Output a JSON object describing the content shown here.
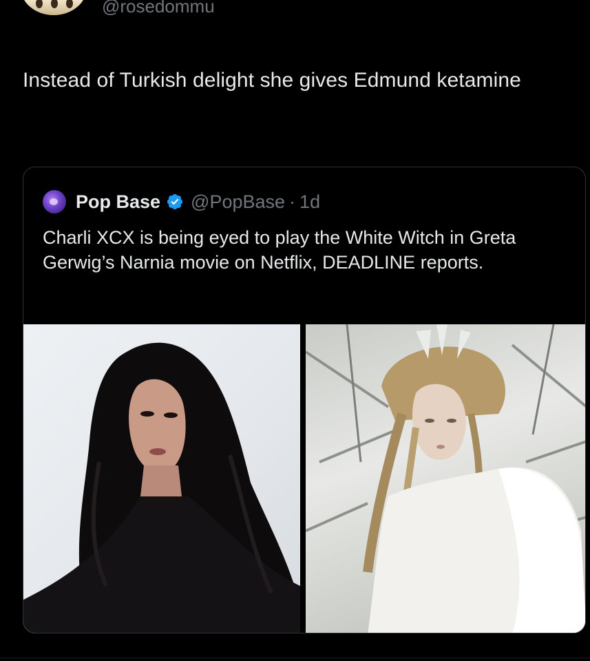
{
  "header": {
    "handle": "@rosedommu"
  },
  "tweet": {
    "text": "Instead of Turkish delight she gives Edmund ketamine"
  },
  "quote": {
    "name": "Pop Base",
    "handle": "@PopBase",
    "separator": "·",
    "time": "1d",
    "text": "Charli XCX is being eyed to play the White Witch in Greta Gerwig’s Narnia movie on Netflix, DEADLINE reports.",
    "verified_color": "#1d9bf0",
    "media": [
      {
        "icon": "photo-portrait-dark-hair"
      },
      {
        "icon": "photo-white-witch-snow"
      }
    ]
  },
  "colors": {
    "background": "#000000",
    "text": "#e7e9ea",
    "muted": "#71767b",
    "border": "#2f3336",
    "accent": "#1d9bf0"
  }
}
